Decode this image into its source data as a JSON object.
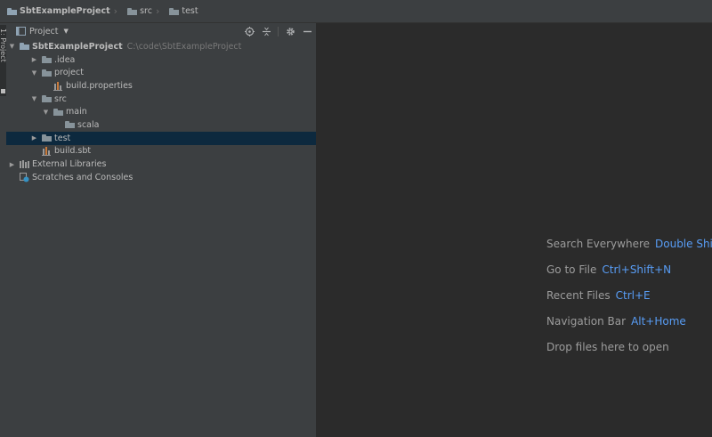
{
  "breadcrumb": [
    {
      "label": "SbtExampleProject",
      "icon": "project-folder-icon",
      "bold": true
    },
    {
      "label": "src",
      "icon": "folder-icon",
      "bold": false
    },
    {
      "label": "test",
      "icon": "folder-icon",
      "bold": false
    }
  ],
  "sidebar_tab": {
    "label": "1: Project"
  },
  "panel": {
    "title": "Project",
    "tools": [
      "locate-icon",
      "collapse-all-icon",
      "settings-gear-icon",
      "hide-minimize-icon"
    ]
  },
  "tree": [
    {
      "level": 0,
      "arrow": "down",
      "icon": "project-folder-icon",
      "label": "SbtExampleProject",
      "bold": true,
      "path": "C:\\code\\SbtExampleProject"
    },
    {
      "level": 1,
      "arrow": "right",
      "icon": "folder-icon",
      "label": ".idea"
    },
    {
      "level": 1,
      "arrow": "down",
      "icon": "folder-icon",
      "label": "project"
    },
    {
      "level": 2,
      "arrow": "none",
      "icon": "properties-file-icon",
      "label": "build.properties"
    },
    {
      "level": 1,
      "arrow": "down",
      "icon": "folder-icon",
      "label": "src"
    },
    {
      "level": 2,
      "arrow": "down",
      "icon": "folder-icon",
      "label": "main"
    },
    {
      "level": 3,
      "arrow": "none",
      "icon": "folder-icon",
      "label": "scala"
    },
    {
      "level": 2,
      "arrow": "right",
      "icon": "folder-icon",
      "label": "test",
      "selected": true
    },
    {
      "level": 1,
      "arrow": "none",
      "icon": "sbt-file-icon",
      "label": "build.sbt"
    },
    {
      "level": 0,
      "arrow": "right",
      "icon": "library-icon",
      "label": "External Libraries"
    },
    {
      "level": 0,
      "arrow": "none",
      "icon": "scratches-icon",
      "label": "Scratches and Consoles"
    }
  ],
  "editor_hints": [
    {
      "text": "Search Everywhere",
      "shortcut": "Double Shift"
    },
    {
      "text": "Go to File",
      "shortcut": "Ctrl+Shift+N"
    },
    {
      "text": "Recent Files",
      "shortcut": "Ctrl+E"
    },
    {
      "text": "Navigation Bar",
      "shortcut": "Alt+Home"
    },
    {
      "text": "Drop files here to open",
      "shortcut": ""
    }
  ],
  "colors": {
    "accent_shortcut": "#589df6",
    "selection": "#0d293e",
    "panel_bg": "#3c3f41",
    "editor_bg": "#2b2b2b"
  }
}
